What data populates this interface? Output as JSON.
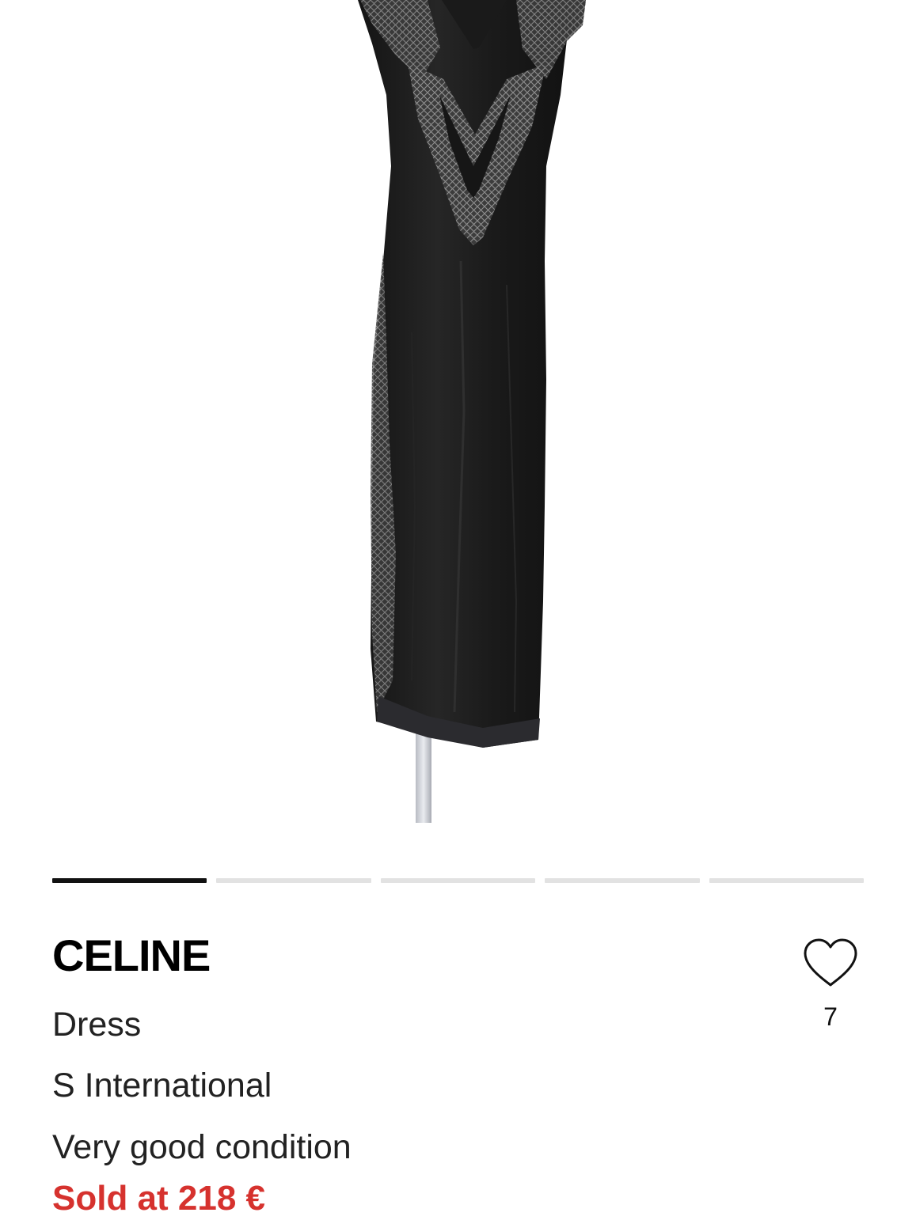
{
  "product": {
    "brand": "CELINE",
    "type": "Dress",
    "size": "S International",
    "condition": "Very good condition",
    "sold_label": "Sold at 218 €"
  },
  "carousel": {
    "count": 5,
    "active_index": 0
  },
  "favorite": {
    "icon": "heart-icon",
    "count": "7"
  },
  "colors": {
    "accent_sold": "#d6322e",
    "indicator_active": "#111111",
    "indicator_inactive": "#e2e2e2"
  }
}
